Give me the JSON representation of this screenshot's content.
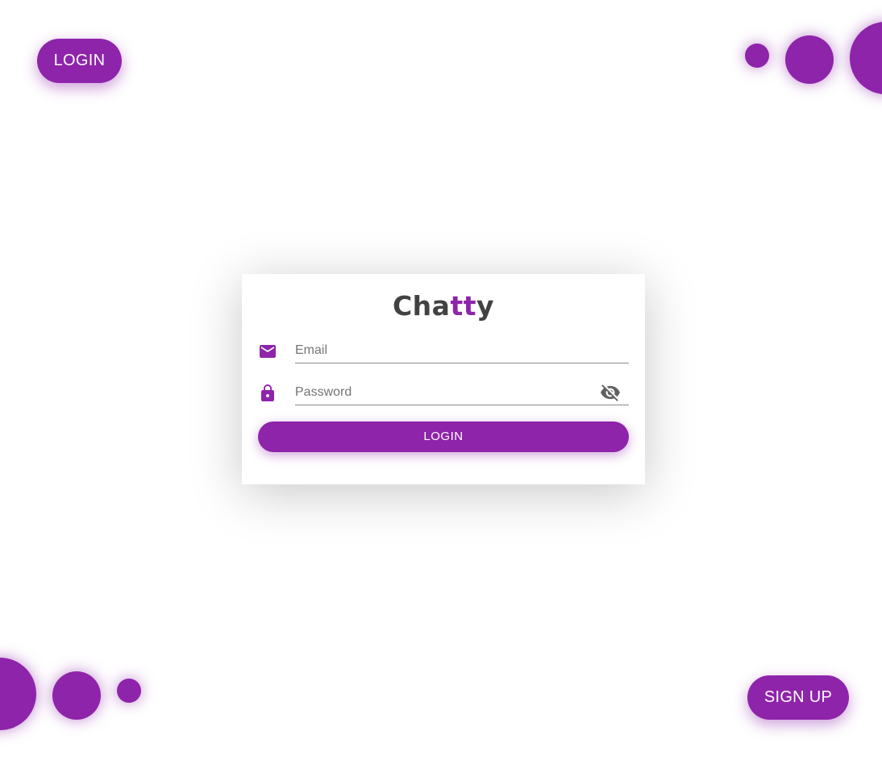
{
  "nav": {
    "login_label": "LOGIN",
    "signup_label": "SIGN UP"
  },
  "brand": {
    "part1": "Cha",
    "part2": "tt",
    "part3": "y",
    "accent_color": "#8e24aa",
    "base_color": "#424242"
  },
  "form": {
    "email": {
      "icon": "mail-icon",
      "value": "",
      "placeholder": "Email"
    },
    "password": {
      "icon": "lock-icon",
      "value": "",
      "placeholder": "Password",
      "toggle_icon": "visibility-off-icon"
    },
    "submit_label": "LOGIN"
  },
  "theme": {
    "primary": "#8e24aa",
    "background": "#ffffff"
  }
}
